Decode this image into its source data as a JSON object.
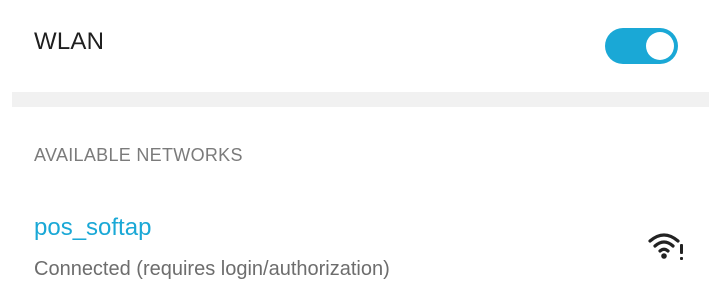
{
  "wlan": {
    "label": "WLAN",
    "toggle_on": true,
    "accent_color": "#1aa8d6"
  },
  "available": {
    "header": "AVAILABLE NETWORKS",
    "networks": [
      {
        "name": "pos_softap",
        "status": "Connected (requires login/authorization)",
        "icon": "wifi-signal-alert-icon"
      }
    ]
  }
}
